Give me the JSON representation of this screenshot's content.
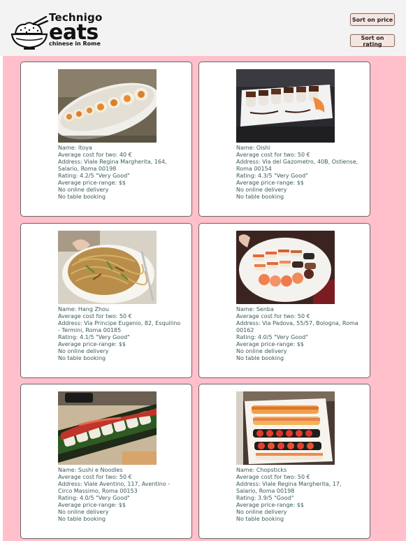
{
  "brand": {
    "top": "Technigo",
    "main": "eats",
    "sub": "chinese in Rome"
  },
  "buttons": {
    "sort_price": "Sort on price",
    "sort_rating": "Sort on rating"
  },
  "labels": {
    "name": "Name: ",
    "cost": "Average cost for two: ",
    "address": "Address: ",
    "rating": "Rating: ",
    "price_range": "Average price-range: "
  },
  "restaurants": [
    {
      "name": "Itoya",
      "cost": "40 €",
      "address": "Viale Regina Margherita, 164, Salario, Roma 00198",
      "rating": "4.2/5 \"Very Good\"",
      "price_range": "$$",
      "delivery": "No online delivery",
      "booking": "No table booking",
      "photo_icon": "sushi-roll-plate-photo"
    },
    {
      "name": "Oishi",
      "cost": "50 €",
      "address": "Via del Gazometro, 40B, Ostiense, Roma 00154",
      "rating": "4.3/5 \"Very Good\"",
      "price_range": "$$",
      "delivery": "No online delivery",
      "booking": "No table booking",
      "photo_icon": "sushi-tray-photo"
    },
    {
      "name": "Hang Zhou",
      "cost": "50 €",
      "address": "Via Principe Eugenio, 82, Esquilino - Termini, Roma 00185",
      "rating": "4.1/5 \"Very Good\"",
      "price_range": "$$",
      "delivery": "No online delivery",
      "booking": "No table booking",
      "photo_icon": "noodles-plate-photo"
    },
    {
      "name": "Senba",
      "cost": "50 €",
      "address": "Via Padova, 55/57, Bologna, Roma 00162",
      "rating": "4.0/5 \"Very Good\"",
      "price_range": "$$",
      "delivery": "No online delivery",
      "booking": "No table booking",
      "photo_icon": "sushi-platter-photo"
    },
    {
      "name": "Sushi e Noodles",
      "cost": "50 €",
      "address": "Viale Aventino, 117, Aventino - Circo Massimo, Roma 00153",
      "rating": "4.0/5 \"Very Good\"",
      "price_range": "$$",
      "delivery": "No online delivery",
      "booking": "No table booking",
      "photo_icon": "sushi-board-photo"
    },
    {
      "name": "Chopsticks",
      "cost": "50 €",
      "address": "Viale Regina Margherita, 17, Salario, Roma 00198",
      "rating": "3.9/5 \"Good\"",
      "price_range": "$$",
      "delivery": "No online delivery",
      "booking": "No table booking",
      "photo_icon": "sushi-boat-photo"
    }
  ],
  "colors": {
    "background": "#ffc0cb",
    "header": "#f3f3f3",
    "text": "#3c5a5a",
    "button_bg": "#f6e6e1"
  }
}
